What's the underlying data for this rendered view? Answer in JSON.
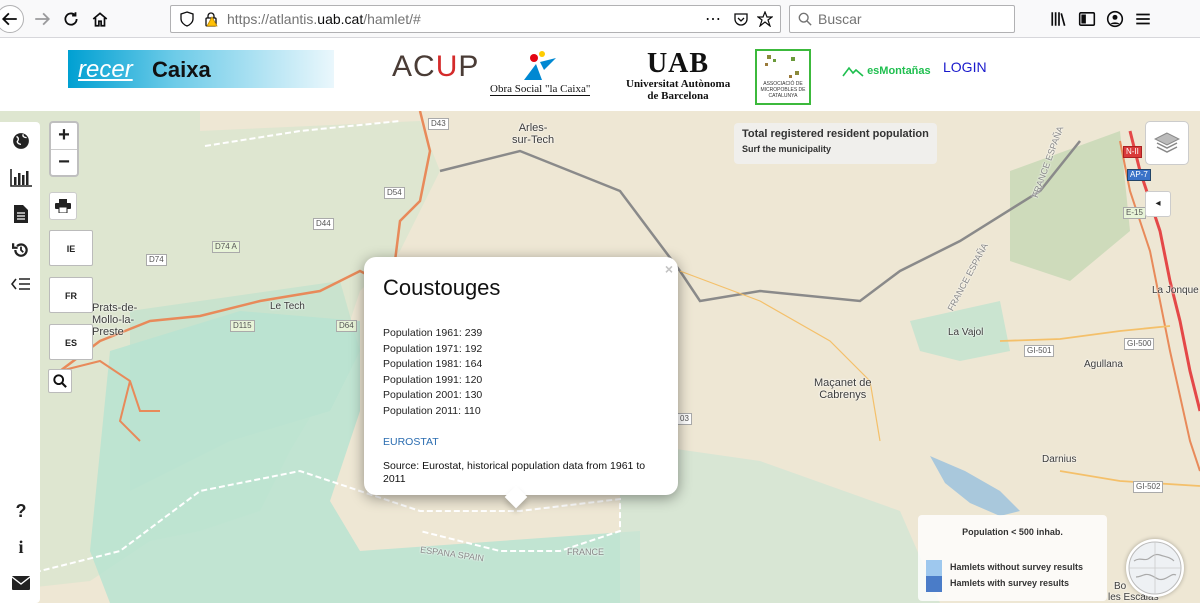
{
  "browser": {
    "url_prefix": "https://atlantis.",
    "url_domain": "uab.cat",
    "url_path": "/hamlet/#",
    "search_placeholder": "Buscar",
    "more_icon": "⋯"
  },
  "header": {
    "recer_part1": "recer",
    "recer_part2": "Caixa",
    "acup_a": "AC",
    "acup_u": "U",
    "acup_p": "P",
    "obra_social": "Obra Social \"la Caixa\"",
    "uab_mark": "UAB",
    "uab_line1": "Universitat Autònoma",
    "uab_line2": "de Barcelona",
    "micro_text": "ASSOCIACIÓ DE MICROPOBLES DE CATALUNYA",
    "esmontanas": "esMontañas",
    "login": "LOGIN"
  },
  "map_controls": {
    "zoom_in": "+",
    "zoom_out": "−",
    "lang_ie": "IE",
    "lang_fr": "FR",
    "lang_es": "ES",
    "collapse": "◂"
  },
  "info_panel": {
    "title": "Total registered resident population",
    "subtitle": "Surf the municipality"
  },
  "popup": {
    "close": "×",
    "title": "Coustouges",
    "populations": [
      "Population 1961: 239",
      "Population 1971: 192",
      "Population 1981: 164",
      "Population 1991: 120",
      "Population 2001: 130",
      "Population 2011: 110"
    ],
    "link": "EUROSTAT",
    "source": "Source: Eurostat, historical population data from 1961 to 2011"
  },
  "legend": {
    "title": "Population < 500 inhab.",
    "item1": "Hamlets without survey results",
    "item2": "Hamlets with survey results",
    "color1": "#9ec8ee",
    "color2": "#4a7cc8"
  },
  "map_labels": {
    "arles_l1": "Arles-",
    "arles_l2": "sur-Tech",
    "prats_l1": "Prats-de-",
    "prats_l2": "Mollo-la-",
    "prats_l3": "Preste",
    "le_tech": "Le Tech",
    "la_vajol": "La Vajol",
    "macanet_l1": "Maçanet de",
    "macanet_l2": "Cabrenys",
    "agullana": "Agullana",
    "darnius": "Darnius",
    "la_jonquera": "La Jonque",
    "france_espana": "FRANCE  ESPAÑA",
    "espana_france": "ESPAÑA  FRANCE",
    "france_bottom": "FRANCE",
    "espana_spain": "ESPANA  SPAIN",
    "france_espana_top": "FRANCE  ESPAÑA",
    "les_escaldes": "les Escalas",
    "bo": "Bo",
    "r_d43": "D43",
    "r_d54": "D54",
    "r_d44": "D44",
    "r_d74a": "D74 A",
    "r_d74": "D74",
    "r_d115": "D115",
    "r_d64": "D64",
    "r_d3": "03",
    "r_gi501": "GI-501",
    "r_gi500": "GI-500",
    "r_gi502": "GI-502",
    "r_n1": "N-II",
    "r_ap7": "AP-7",
    "r_e15": "E-15"
  }
}
